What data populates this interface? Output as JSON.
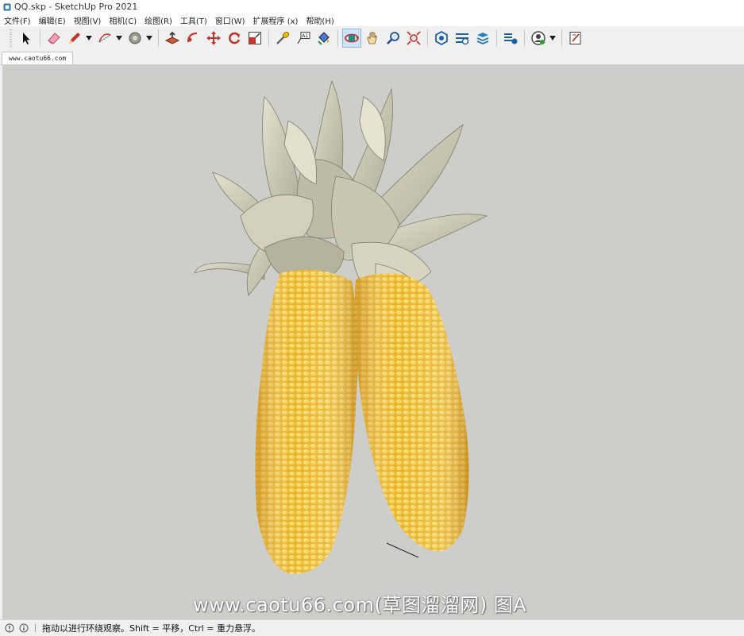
{
  "window": {
    "title": "QQ.skp - SketchUp Pro 2021"
  },
  "menu": [
    "文件(F)",
    "编辑(E)",
    "视图(V)",
    "相机(C)",
    "绘图(R)",
    "工具(T)",
    "窗口(W)",
    "扩展程序 (x)",
    "帮助(H)"
  ],
  "toolbar": {
    "icons": [
      "select-tool-icon",
      "eraser-tool-icon",
      "pencil-line-tool-icon",
      "arc-tool-icon",
      "paint-bucket-tool-icon",
      "push-pull-tool-icon",
      "follow-me-tool-icon",
      "move-tool-icon",
      "rotate-tool-icon",
      "scale-tool-icon",
      "tape-measure-tool-icon",
      "text-tool-icon",
      "paint-tool-icon",
      "orbit-tool-icon",
      "pan-tool-icon",
      "zoom-tool-icon",
      "zoom-extents-tool-icon",
      "3d-warehouse-icon",
      "extension-warehouse-icon",
      "layout-send-icon",
      "extension-manager-icon",
      "account-icon",
      "send-to-layout-icon"
    ],
    "active": "orbit-tool-icon"
  },
  "tabs": {
    "scene_tab": "www.caotu66.com"
  },
  "viewport": {
    "watermark": "www.caotu66.com(草图溜溜网) 图A"
  },
  "status": {
    "text": "拖动以进行环绕观察。Shift = 平移，Ctrl = 重力悬浮。"
  },
  "colors": {
    "viewport_bg": "#cdcdca",
    "corn_yellow": "#f2c23c",
    "husk_leaf": "#cfcdb8",
    "active_tool_bg": "#cfe3f7"
  }
}
